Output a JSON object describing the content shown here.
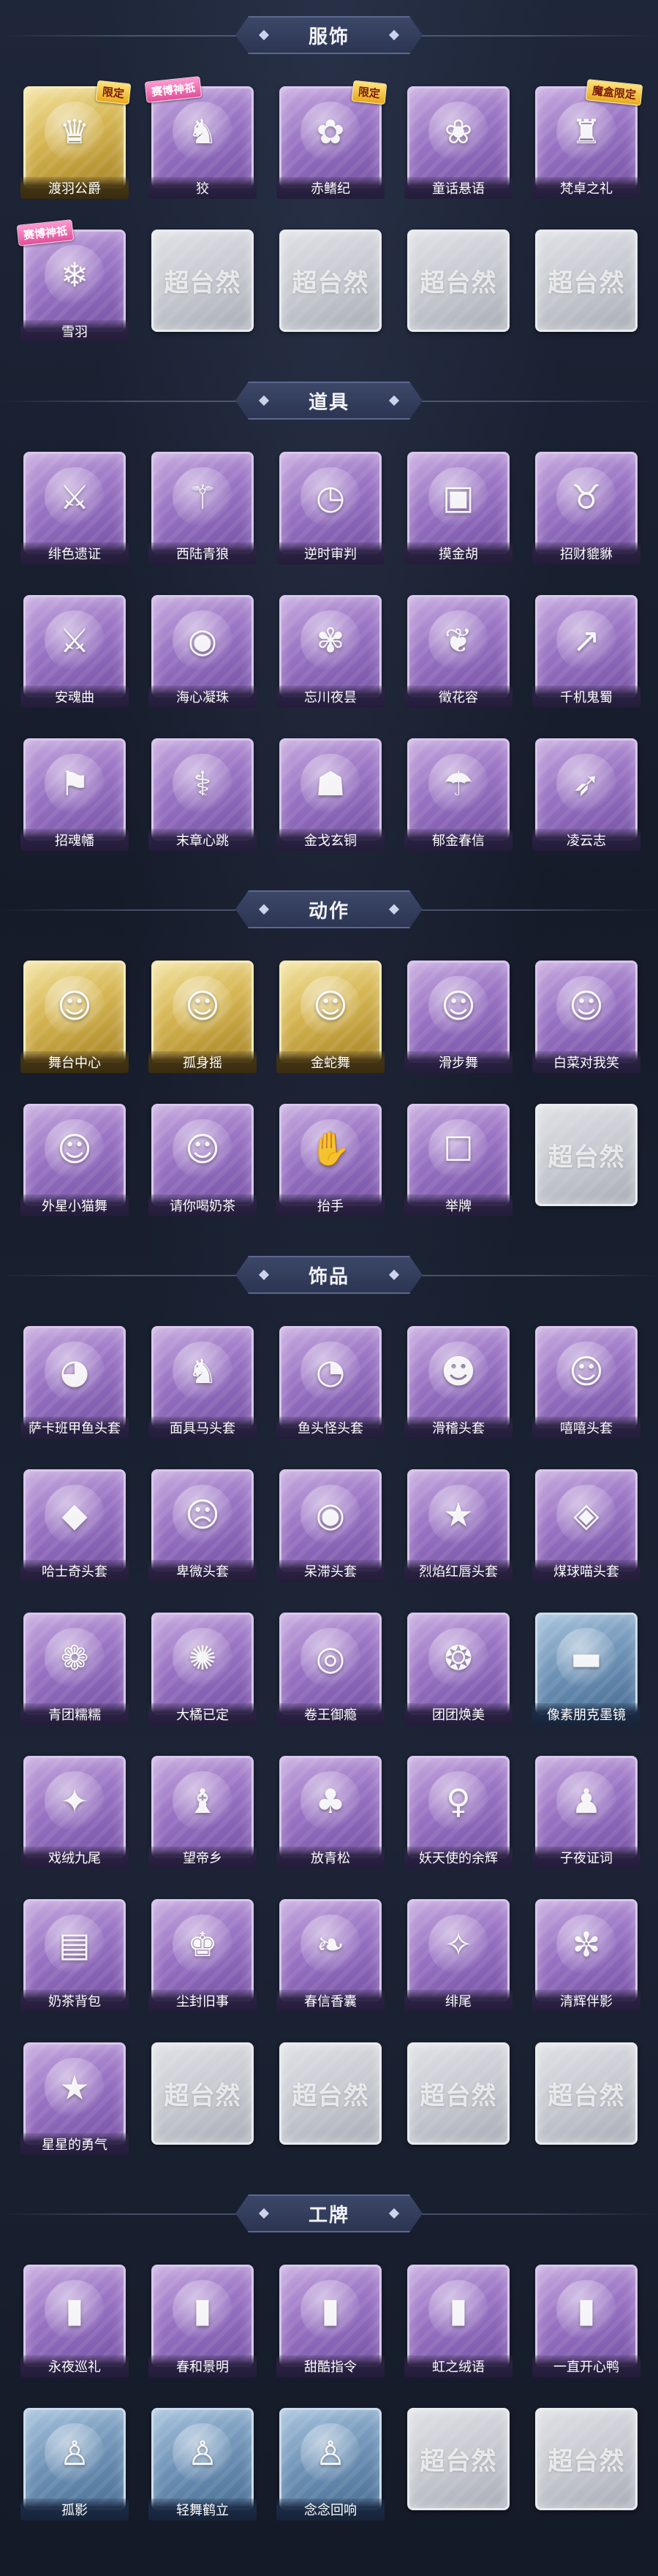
{
  "sections": [
    {
      "title": "服饰",
      "items": [
        {
          "name": "渡羽公爵",
          "style": "gold",
          "icon": "character-portrait-icon",
          "glyph": "♛",
          "badge": "限定",
          "badge_style": "xianding"
        },
        {
          "name": "狡",
          "style": "purple",
          "icon": "character-portrait-icon",
          "glyph": "♞",
          "badge": "赛博神祇",
          "badge_style": "shenzhao"
        },
        {
          "name": "赤鳍纪",
          "style": "purple",
          "icon": "character-portrait-icon",
          "glyph": "✿",
          "badge": "限定",
          "badge_style": "xianding"
        },
        {
          "name": "童话悬语",
          "style": "purple",
          "icon": "character-portrait-icon",
          "glyph": "❀",
          "badge": "",
          "badge_style": ""
        },
        {
          "name": "梵卓之礼",
          "style": "purple",
          "icon": "character-portrait-icon",
          "glyph": "♜",
          "badge": "魔盒限定",
          "badge_style": "xianding"
        },
        {
          "name": "雪羽",
          "style": "purple",
          "icon": "character-portrait-icon",
          "glyph": "❄",
          "badge": "赛博神祇",
          "badge_style": "shenzhao"
        },
        {
          "name": "",
          "style": "empty",
          "icon": "",
          "glyph": "",
          "badge": "",
          "badge_style": "",
          "watermark": "超台然"
        },
        {
          "name": "",
          "style": "empty",
          "icon": "",
          "glyph": "",
          "badge": "",
          "badge_style": "",
          "watermark": "超台然"
        },
        {
          "name": "",
          "style": "empty",
          "icon": "",
          "glyph": "",
          "badge": "",
          "badge_style": "",
          "watermark": "超台然"
        },
        {
          "name": "",
          "style": "empty",
          "icon": "",
          "glyph": "",
          "badge": "",
          "badge_style": "",
          "watermark": "超台然"
        }
      ]
    },
    {
      "title": "道具",
      "items": [
        {
          "name": "绯色遗证",
          "style": "purple",
          "icon": "sword-icon",
          "glyph": "⚔",
          "badge": "",
          "badge_style": ""
        },
        {
          "name": "西陆青狼",
          "style": "purple",
          "icon": "staff-icon",
          "glyph": "⚚",
          "badge": "",
          "badge_style": ""
        },
        {
          "name": "逆时审判",
          "style": "purple",
          "icon": "pocket-watch-icon",
          "glyph": "◷",
          "badge": "",
          "badge_style": ""
        },
        {
          "name": "摸金胡",
          "style": "purple",
          "icon": "mahjong-tile-icon",
          "glyph": "▣",
          "badge": "",
          "badge_style": ""
        },
        {
          "name": "招财貔貅",
          "style": "purple",
          "icon": "beast-icon",
          "glyph": "♉",
          "badge": "",
          "badge_style": ""
        },
        {
          "name": "安魂曲",
          "style": "purple",
          "icon": "blade-icon",
          "glyph": "⚔",
          "badge": "",
          "badge_style": ""
        },
        {
          "name": "海心凝珠",
          "style": "purple",
          "icon": "pearl-shell-icon",
          "glyph": "◉",
          "badge": "",
          "badge_style": ""
        },
        {
          "name": "忘川夜昙",
          "style": "purple",
          "icon": "flower-icon",
          "glyph": "✾",
          "badge": "",
          "badge_style": ""
        },
        {
          "name": "徵花容",
          "style": "purple",
          "icon": "flower-branch-icon",
          "glyph": "❦",
          "badge": "",
          "badge_style": ""
        },
        {
          "name": "千机鬼蜀",
          "style": "purple",
          "icon": "spear-icon",
          "glyph": "↗",
          "badge": "",
          "badge_style": ""
        },
        {
          "name": "招魂幡",
          "style": "purple",
          "icon": "banner-flag-icon",
          "glyph": "⚑",
          "badge": "",
          "badge_style": ""
        },
        {
          "name": "末章心跳",
          "style": "purple",
          "icon": "scepter-icon",
          "glyph": "⚕",
          "badge": "",
          "badge_style": ""
        },
        {
          "name": "金戈玄铜",
          "style": "purple",
          "icon": "lantern-icon",
          "glyph": "☗",
          "badge": "",
          "badge_style": ""
        },
        {
          "name": "郁金春信",
          "style": "purple",
          "icon": "umbrella-icon",
          "glyph": "☂",
          "badge": "",
          "badge_style": ""
        },
        {
          "name": "凌云志",
          "style": "purple",
          "icon": "bow-icon",
          "glyph": "➶",
          "badge": "",
          "badge_style": ""
        }
      ]
    },
    {
      "title": "动作",
      "items": [
        {
          "name": "舞台中心",
          "style": "gold",
          "icon": "dance-pose-icon",
          "glyph": "☺",
          "badge": "",
          "badge_style": ""
        },
        {
          "name": "孤身摇",
          "style": "gold",
          "icon": "dance-pose-icon",
          "glyph": "☺",
          "badge": "",
          "badge_style": ""
        },
        {
          "name": "金蛇舞",
          "style": "gold",
          "icon": "dance-pose-icon",
          "glyph": "☺",
          "badge": "",
          "badge_style": ""
        },
        {
          "name": "滑步舞",
          "style": "purple",
          "icon": "dance-pose-icon",
          "glyph": "☺",
          "badge": "",
          "badge_style": ""
        },
        {
          "name": "白菜对我笑",
          "style": "purple",
          "icon": "dance-pose-icon",
          "glyph": "☺",
          "badge": "",
          "badge_style": ""
        },
        {
          "name": "外星小猫舞",
          "style": "purple",
          "icon": "dance-pose-icon",
          "glyph": "☺",
          "badge": "",
          "badge_style": ""
        },
        {
          "name": "请你喝奶茶",
          "style": "purple",
          "icon": "dance-pose-icon",
          "glyph": "☺",
          "badge": "",
          "badge_style": ""
        },
        {
          "name": "抬手",
          "style": "purple",
          "icon": "hand-raise-icon",
          "glyph": "✋",
          "badge": "",
          "badge_style": ""
        },
        {
          "name": "举牌",
          "style": "purple",
          "icon": "sign-hold-icon",
          "glyph": "☐",
          "badge": "",
          "badge_style": ""
        },
        {
          "name": "",
          "style": "empty",
          "icon": "",
          "glyph": "",
          "badge": "",
          "badge_style": "",
          "watermark": "超台然"
        }
      ]
    },
    {
      "title": "饰品",
      "items": [
        {
          "name": "萨卡班甲鱼头套",
          "style": "purple",
          "icon": "fish-head-icon",
          "glyph": "◕",
          "badge": "",
          "badge_style": ""
        },
        {
          "name": "面具马头套",
          "style": "purple",
          "icon": "horse-head-icon",
          "glyph": "♞",
          "badge": "",
          "badge_style": ""
        },
        {
          "name": "鱼头怪头套",
          "style": "purple",
          "icon": "fish-monster-icon",
          "glyph": "◔",
          "badge": "",
          "badge_style": ""
        },
        {
          "name": "滑稽头套",
          "style": "purple",
          "icon": "smiley-icon",
          "glyph": "☻",
          "badge": "",
          "badge_style": ""
        },
        {
          "name": "嘻嘻头套",
          "style": "purple",
          "icon": "grin-icon",
          "glyph": "☺",
          "badge": "",
          "badge_style": ""
        },
        {
          "name": "哈士奇头套",
          "style": "purple",
          "icon": "dog-head-icon",
          "glyph": "◆",
          "badge": "",
          "badge_style": ""
        },
        {
          "name": "卑微头套",
          "style": "purple",
          "icon": "sad-face-icon",
          "glyph": "☹",
          "badge": "",
          "badge_style": ""
        },
        {
          "name": "呆滞头套",
          "style": "purple",
          "icon": "blank-face-icon",
          "glyph": "◉",
          "badge": "",
          "badge_style": ""
        },
        {
          "name": "烈焰红唇头套",
          "style": "purple",
          "icon": "pikachu-head-icon",
          "glyph": "★",
          "badge": "",
          "badge_style": ""
        },
        {
          "name": "煤球喵头套",
          "style": "purple",
          "icon": "cat-head-icon",
          "glyph": "◈",
          "badge": "",
          "badge_style": ""
        },
        {
          "name": "青团糯糯",
          "style": "purple",
          "icon": "rice-cake-icon",
          "glyph": "❁",
          "badge": "",
          "badge_style": ""
        },
        {
          "name": "大橘已定",
          "style": "purple",
          "icon": "orange-icon",
          "glyph": "✺",
          "badge": "",
          "badge_style": ""
        },
        {
          "name": "卷王御瘾",
          "style": "purple",
          "icon": "roll-cake-icon",
          "glyph": "◎",
          "badge": "",
          "badge_style": ""
        },
        {
          "name": "团团焕美",
          "style": "purple",
          "icon": "bun-icon",
          "glyph": "❂",
          "badge": "",
          "badge_style": ""
        },
        {
          "name": "像素朋克墨镜",
          "style": "blue",
          "icon": "pixel-sunglasses-icon",
          "glyph": "▬",
          "badge": "",
          "badge_style": ""
        },
        {
          "name": "戏绒九尾",
          "style": "purple",
          "icon": "fox-icon",
          "glyph": "✦",
          "badge": "",
          "badge_style": ""
        },
        {
          "name": "望帝乡",
          "style": "purple",
          "icon": "figure-icon",
          "glyph": "♝",
          "badge": "",
          "badge_style": ""
        },
        {
          "name": "放青松",
          "style": "purple",
          "icon": "pine-tree-icon",
          "glyph": "♣",
          "badge": "",
          "badge_style": ""
        },
        {
          "name": "妖天使的余辉",
          "style": "purple",
          "icon": "angel-figure-icon",
          "glyph": "♀",
          "badge": "",
          "badge_style": ""
        },
        {
          "name": "子夜证词",
          "style": "purple",
          "icon": "figure-icon",
          "glyph": "♟",
          "badge": "",
          "badge_style": ""
        },
        {
          "name": "奶茶背包",
          "style": "purple",
          "icon": "backpack-icon",
          "glyph": "▤",
          "badge": "",
          "badge_style": ""
        },
        {
          "name": "尘封旧事",
          "style": "purple",
          "icon": "figure-icon",
          "glyph": "♚",
          "badge": "",
          "badge_style": ""
        },
        {
          "name": "春信香囊",
          "style": "purple",
          "icon": "sachet-icon",
          "glyph": "❧",
          "badge": "",
          "badge_style": ""
        },
        {
          "name": "绯尾",
          "style": "purple",
          "icon": "fox-icon",
          "glyph": "✧",
          "badge": "",
          "badge_style": ""
        },
        {
          "name": "清辉伴影",
          "style": "purple",
          "icon": "bunny-icon",
          "glyph": "✼",
          "badge": "",
          "badge_style": ""
        },
        {
          "name": "星星的勇气",
          "style": "purple",
          "icon": "star-charm-icon",
          "glyph": "★",
          "badge": "",
          "badge_style": ""
        },
        {
          "name": "",
          "style": "empty",
          "icon": "",
          "glyph": "",
          "badge": "",
          "badge_style": "",
          "watermark": "超台然"
        },
        {
          "name": "",
          "style": "empty",
          "icon": "",
          "glyph": "",
          "badge": "",
          "badge_style": "",
          "watermark": "超台然"
        },
        {
          "name": "",
          "style": "empty",
          "icon": "",
          "glyph": "",
          "badge": "",
          "badge_style": "",
          "watermark": "超台然"
        },
        {
          "name": "",
          "style": "empty",
          "icon": "",
          "glyph": "",
          "badge": "",
          "badge_style": "",
          "watermark": "超台然"
        }
      ]
    },
    {
      "title": "工牌",
      "items": [
        {
          "name": "永夜巡礼",
          "style": "purple",
          "icon": "badge-card-icon",
          "glyph": "▮",
          "badge": "",
          "badge_style": ""
        },
        {
          "name": "春和景明",
          "style": "purple",
          "icon": "badge-card-icon",
          "glyph": "▮",
          "badge": "",
          "badge_style": ""
        },
        {
          "name": "甜酷指令",
          "style": "purple",
          "icon": "badge-card-icon",
          "glyph": "▮",
          "badge": "",
          "badge_style": ""
        },
        {
          "name": "虹之绒语",
          "style": "purple",
          "icon": "badge-card-icon",
          "glyph": "▮",
          "badge": "",
          "badge_style": ""
        },
        {
          "name": "一直开心鸭",
          "style": "purple",
          "icon": "badge-card-icon",
          "glyph": "▮",
          "badge": "",
          "badge_style": ""
        },
        {
          "name": "孤影",
          "style": "blue",
          "icon": "silhouette-card-icon",
          "glyph": "♙",
          "badge": "",
          "badge_style": ""
        },
        {
          "name": "轻舞鹤立",
          "style": "blue",
          "icon": "silhouette-card-icon",
          "glyph": "♙",
          "badge": "",
          "badge_style": ""
        },
        {
          "name": "念念回响",
          "style": "blue",
          "icon": "silhouette-card-icon",
          "glyph": "♙",
          "badge": "",
          "badge_style": ""
        },
        {
          "name": "",
          "style": "empty",
          "icon": "",
          "glyph": "",
          "badge": "",
          "badge_style": "",
          "watermark": "超台然"
        },
        {
          "name": "",
          "style": "empty",
          "icon": "",
          "glyph": "",
          "badge": "",
          "badge_style": "",
          "watermark": "超台然"
        }
      ]
    }
  ]
}
